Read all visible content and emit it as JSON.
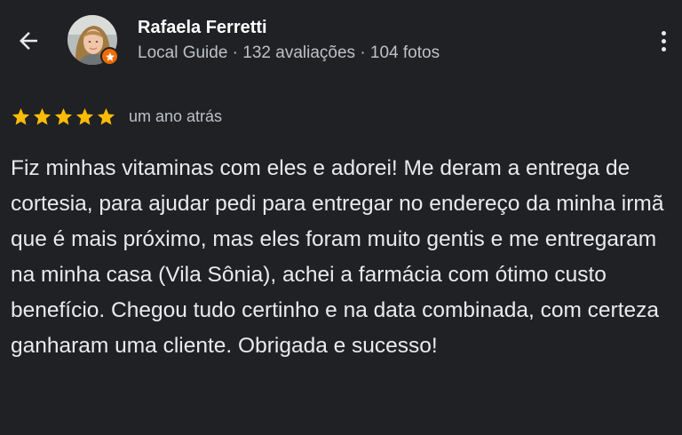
{
  "navigation": {
    "back_icon": "arrow-left-icon",
    "more_icon": "more-vertical-icon"
  },
  "reviewer": {
    "name": "Rafaela Ferretti",
    "meta": "Local Guide · 132 avaliações · 104 fotos",
    "badge_icon": "local-guide-star-icon",
    "badge_color": "#ef6c00"
  },
  "review": {
    "rating": 5,
    "max_rating": 5,
    "star_color": "#fbbc04",
    "time_ago": "um ano atrás",
    "text": "Fiz minhas vitaminas com eles e adorei! Me deram a entrega de cortesia, para ajudar pedi para entregar no endereço da minha irmã que é mais próximo, mas eles foram muito gentis e me entregaram na minha casa (Vila Sônia), achei a farmácia com ótimo custo benefício. Chegou tudo certinho e na data combinada, com certeza ganharam uma cliente. Obrigada e sucesso!"
  },
  "theme": {
    "background": "#202124",
    "primary_text": "#e8eaed",
    "secondary_text": "#bdc1c6"
  }
}
